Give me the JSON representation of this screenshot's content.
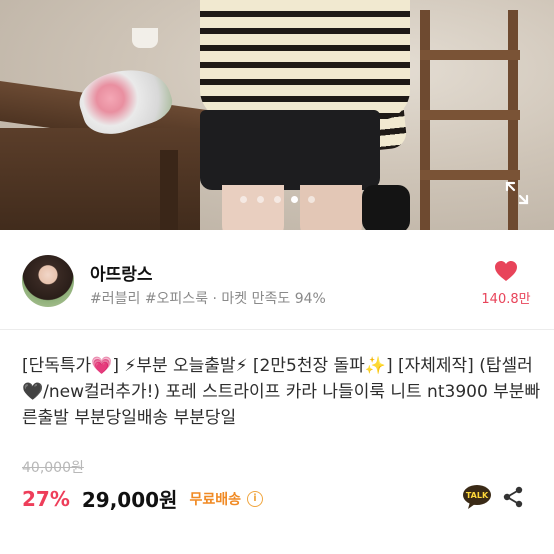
{
  "gallery": {
    "image_icon": "product-photo",
    "slide_count": 5,
    "active_slide": 4,
    "expand_icon": "expand-icon"
  },
  "seller": {
    "name": "아뜨랑스",
    "meta": "#러블리 #오피스룩 · 마켓 만족도 94%",
    "like_icon": "heart-icon",
    "like_count": "140.8만"
  },
  "product": {
    "title": "[단독특가💗] ⚡부분 오늘출발⚡ [2만5천장 돌파✨] [자체제작] (탑셀러🖤/new컬러추가!) 포레 스트라이프 카라 나들이룩 니트 nt3900 부분빠른출발 부분당일배송 부분당일",
    "original_price": "40,000원",
    "discount": "27%",
    "price": "29,000원",
    "shipping": "무료배송",
    "shipping_info_icon": "info-icon",
    "talk_label": "TALK",
    "share_icon": "share-icon"
  },
  "colors": {
    "accent_red": "#ee3e5a",
    "heart": "#e8445a",
    "shipping_orange": "#f08a24",
    "talk_yellow": "#3a2a16"
  }
}
